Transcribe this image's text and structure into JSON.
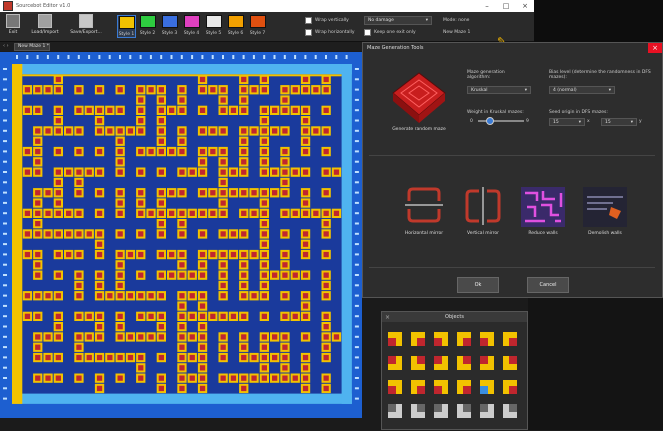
{
  "window": {
    "title": "Sourcebot Editor v1.0"
  },
  "toolbar": {
    "buttons": [
      {
        "label": "Exit"
      },
      {
        "label": "Load/Import"
      },
      {
        "label": "Save/Export..."
      }
    ],
    "styles": [
      {
        "label": "Style 1",
        "color": "#f2c200"
      },
      {
        "label": "Style 2",
        "color": "#2ecc40"
      },
      {
        "label": "Style 3",
        "color": "#3a6fe0"
      },
      {
        "label": "Style 4",
        "color": "#e040c0"
      },
      {
        "label": "Style 5",
        "color": "#e8e8e8"
      },
      {
        "label": "Style 6",
        "color": "#f2a000"
      },
      {
        "label": "Style 7",
        "color": "#e05010"
      }
    ],
    "wrap_vertically": "Wrap vertically",
    "wrap_horizontally": "Wrap horizontally",
    "damage_select": "No damage",
    "keep_exit": "Keep one exit only",
    "mode_label": "Mode: none",
    "maze_name": "New Maze 1"
  },
  "tab": {
    "label": "New Maze 1 *"
  },
  "dialog": {
    "title": "Maze Generation Tools",
    "generate_caption": "Generate random maze",
    "algo_label": "Maze generation algorithm:",
    "algo_value": "Kruskal",
    "bias_label": "Bias level (determine the randomness in DFS mazes):",
    "bias_value": "4 (normal)",
    "weight_label": "Weight in Kruskal mazes:",
    "weight_min": "0",
    "weight_max": "9",
    "weight_value": 0.2,
    "seed_label": "Seed origin in DFS mazes:",
    "seed_x": "15",
    "seed_y": "15",
    "seed_x_suffix": "x",
    "seed_y_suffix": "y",
    "tools": [
      {
        "label": "Horizontal mirror"
      },
      {
        "label": "Vertical mirror"
      },
      {
        "label": "Reduce walls"
      },
      {
        "label": "Demolish walls"
      }
    ],
    "ok_label": "Ok",
    "cancel_label": "Cancel"
  },
  "objects_panel": {
    "title": "Objects"
  },
  "colors": {
    "maze_bg": "#1a3a9c",
    "wall": "#f2c200",
    "wall_core": "#c0262e",
    "border": "#4fb3f0",
    "ruler": "#1d5fd0"
  }
}
